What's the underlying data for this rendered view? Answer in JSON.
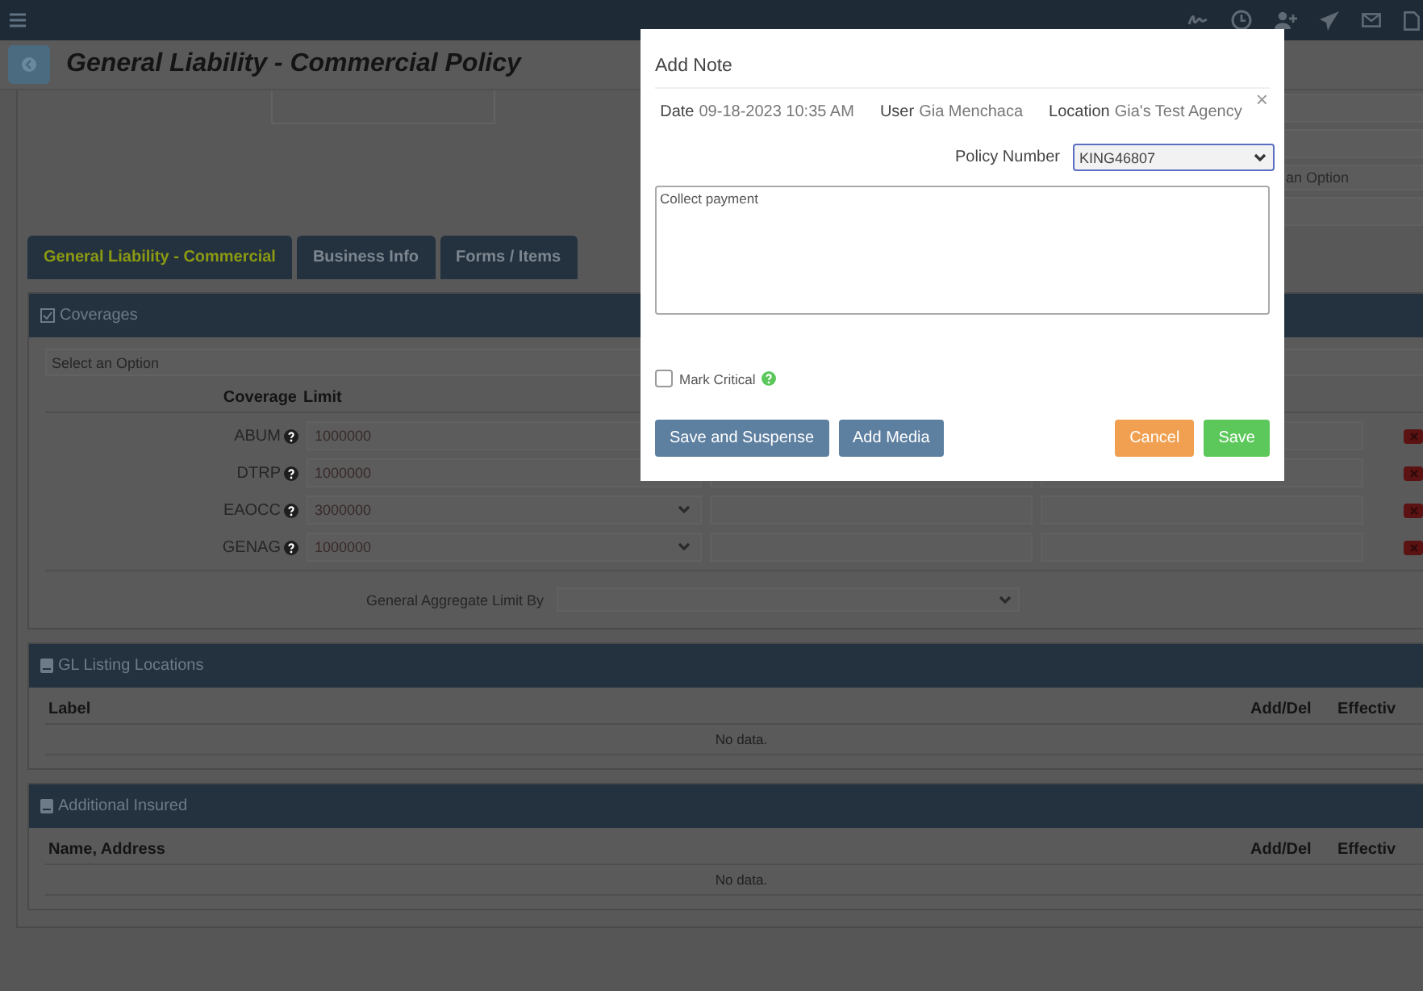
{
  "page": {
    "title": "General Liability - Commercial Policy"
  },
  "side_field": {
    "placeholder": "an Option"
  },
  "tabs": [
    {
      "label": "General Liability - Commercial",
      "selected": true
    },
    {
      "label": "Business Info",
      "selected": false
    },
    {
      "label": "Forms / Items",
      "selected": false
    }
  ],
  "coverages": {
    "title": "Coverages",
    "select_placeholder": "Select an Option",
    "columns": [
      "Coverage",
      "Limit"
    ],
    "rows": [
      {
        "code": "ABUM",
        "limit": "1000000",
        "kind": "text"
      },
      {
        "code": "DTRP",
        "limit": "1000000",
        "kind": "text"
      },
      {
        "code": "EAOCC",
        "limit": "3000000",
        "kind": "select"
      },
      {
        "code": "GENAG",
        "limit": "1000000",
        "kind": "select"
      }
    ],
    "aggregate_label": "General Aggregate Limit By"
  },
  "sections": [
    {
      "title": "GL Listing Locations",
      "columns": [
        "Label",
        "Add/Del",
        "Effectiv"
      ],
      "empty": "No data."
    },
    {
      "title": "Additional Insured",
      "columns": [
        "Name, Address",
        "Add/Del",
        "Effectiv"
      ],
      "empty": "No data."
    }
  ],
  "modal": {
    "title": "Add Note",
    "close": "×",
    "date_label": "Date",
    "date": "09-18-2023 10:35 AM",
    "user_label": "User",
    "user": "Gia Menchaca",
    "location_label": "Location",
    "location": "Gia's Test Agency",
    "policy_label": "Policy Number",
    "policy": "KING46807",
    "note": "Collect payment",
    "mark_critical": {
      "label": "Mark Critical",
      "checked": false
    },
    "buttons": [
      {
        "label": "Save and Suspense",
        "kind": "primary"
      },
      {
        "label": "Add Media",
        "kind": "primary"
      },
      {
        "label": "Cancel",
        "kind": "warning"
      },
      {
        "label": "Save",
        "kind": "success"
      }
    ]
  }
}
